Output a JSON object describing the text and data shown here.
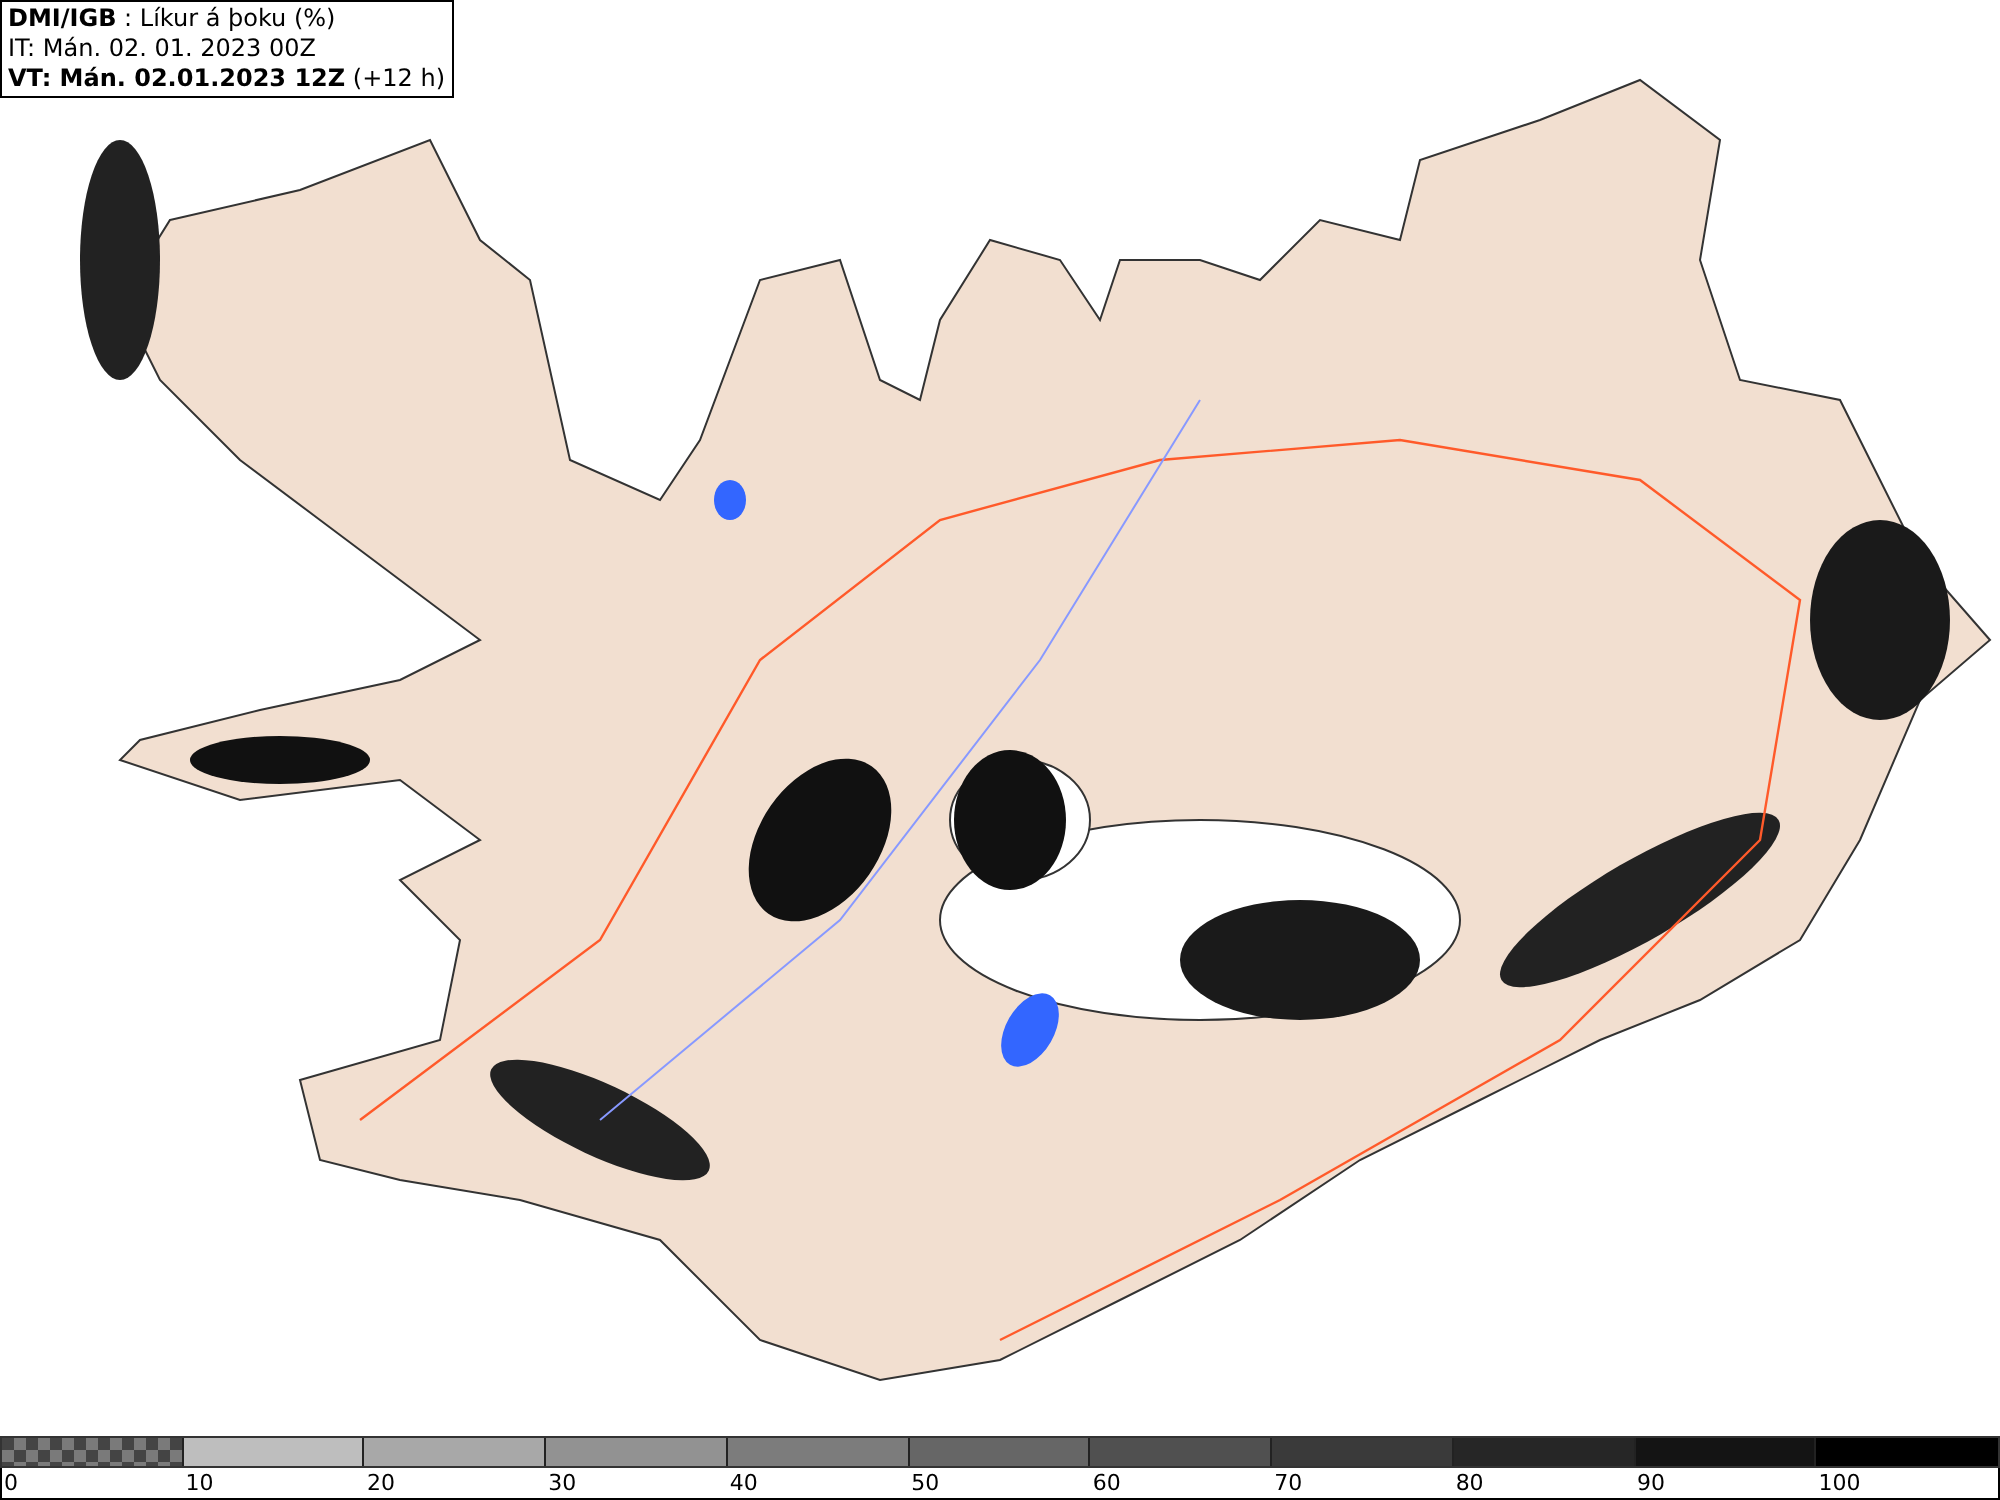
{
  "header": {
    "lines": [
      "**DMI/IGB** : Líkur á þoku (%)",
      "IT: Mán. 02. 01. 2023 00Z",
      "**VT: Mán. 02.01.2023 12Z** (+12 h)"
    ]
  },
  "legend": {
    "segments": [
      {
        "kind": "checker",
        "color": "#7a7a7a"
      },
      {
        "kind": "solid",
        "color": "#bebebe"
      },
      {
        "kind": "solid",
        "color": "#a8a8a8"
      },
      {
        "kind": "solid",
        "color": "#929292"
      },
      {
        "kind": "solid",
        "color": "#7c7c7c"
      },
      {
        "kind": "solid",
        "color": "#666666"
      },
      {
        "kind": "solid",
        "color": "#505050"
      },
      {
        "kind": "solid",
        "color": "#3a3a3a"
      },
      {
        "kind": "solid",
        "color": "#262626"
      },
      {
        "kind": "solid",
        "color": "#141414"
      },
      {
        "kind": "solid",
        "color": "#000000"
      }
    ],
    "labels": [
      "0",
      "10",
      "20",
      "30",
      "40",
      "50",
      "60",
      "70",
      "80",
      "90",
      "100"
    ]
  }
}
